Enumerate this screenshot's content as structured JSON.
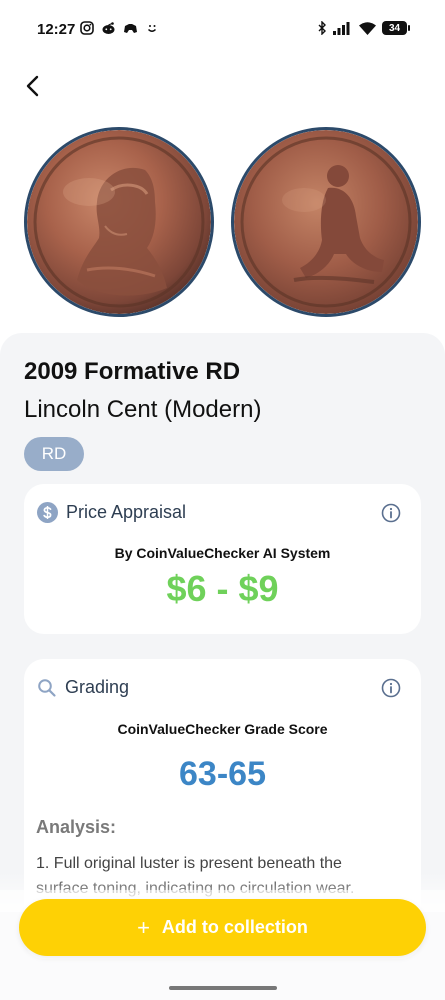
{
  "status_bar": {
    "time": "12:27",
    "battery": "34"
  },
  "coin": {
    "title": "2009 Formative RD",
    "subtitle": "Lincoln Cent (Modern)",
    "grade_chip": "RD"
  },
  "price_card": {
    "title": "Price Appraisal",
    "by_line": "By CoinValueChecker AI System",
    "range": "$6 - $9"
  },
  "grading_card": {
    "title": "Grading",
    "score_label": "CoinValueChecker Grade Score",
    "score": "63-65",
    "analysis_heading": "Analysis:",
    "analysis_text": "1. Full original luster is present beneath the surface toning, indicating no circulation wear."
  },
  "actions": {
    "add_label": "Add to collection",
    "add_icon": "+"
  },
  "colors": {
    "accent_yellow": "#FED105",
    "price_green": "#6FD15A",
    "grade_blue": "#3C86C6",
    "chip_blue": "#98ADC9"
  }
}
